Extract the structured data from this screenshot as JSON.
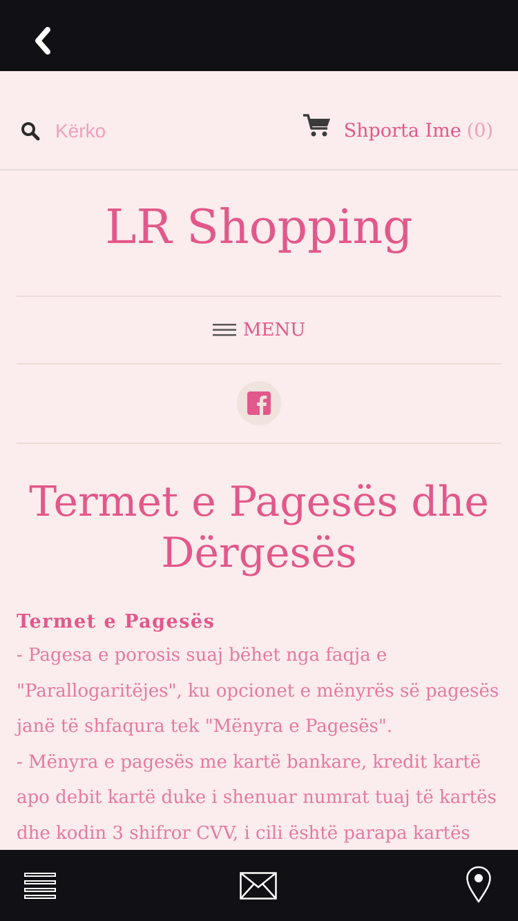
{
  "header": {
    "search_placeholder": "Kërko",
    "cart_label": "Shporta Ime",
    "cart_count": "(0)"
  },
  "brand": "LR Shopping",
  "menu_label": "MENU",
  "page": {
    "title": "Termet e Pagesës dhe Dërgesës",
    "section_heading": "Termet e Pagesës",
    "paragraph_1": "- Pagesa e porosis suaj bëhet nga faqja e \"Parallogaritëjes\", ku opcionet e mënyrës së pagesës janë të shfaqura tek \"Mënyra e Pagesës\".",
    "paragraph_2": "- Mënyra e pagesës me kartë bankare, kredit kartë apo debit kartë duke i shenuar numrat tuaj të kartës dhe kodin 3 shifror CVV, i cili është parapa kartës suaj."
  },
  "colors": {
    "accent": "#e2588a",
    "light_accent": "#efa0bc",
    "background": "#fbeced",
    "bars": "#111014"
  },
  "icons": [
    "back-chevron-icon",
    "search-icon",
    "cart-icon",
    "hamburger-icon",
    "facebook-icon",
    "list-icon",
    "mail-icon",
    "location-pin-icon"
  ]
}
